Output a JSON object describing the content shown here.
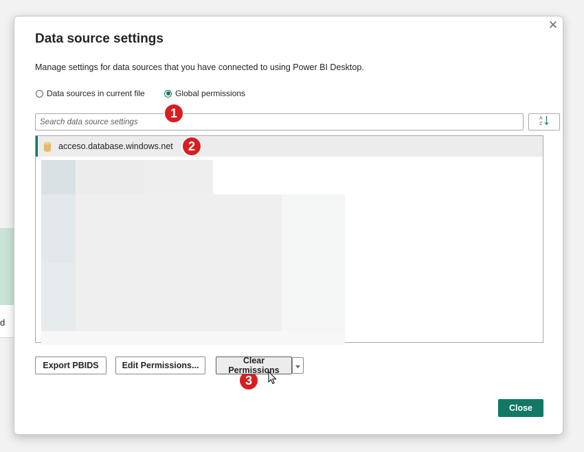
{
  "background": {
    "edge_text": "d"
  },
  "dialog": {
    "close_glyph": "✕",
    "title": "Data source settings",
    "description": "Manage settings for data sources that you have connected to using Power BI Desktop.",
    "scope_options": [
      {
        "label": "Data sources in current file",
        "selected": false
      },
      {
        "label": "Global permissions",
        "selected": true
      }
    ],
    "search": {
      "placeholder": "Search data source settings",
      "value": ""
    },
    "sort_icon": "sort-az-icon",
    "data_sources": [
      {
        "name": "acceso.database.windows.net",
        "icon": "database-icon",
        "selected": true
      }
    ],
    "buttons": {
      "export": "Export PBIDS",
      "edit": "Edit Permissions...",
      "clear": "Clear Permissions",
      "close": "Close"
    },
    "annotations": [
      "1",
      "2",
      "3"
    ]
  },
  "colors": {
    "accent": "#117865",
    "marker": "#d81e1e",
    "db_icon": "#e8b96a"
  }
}
